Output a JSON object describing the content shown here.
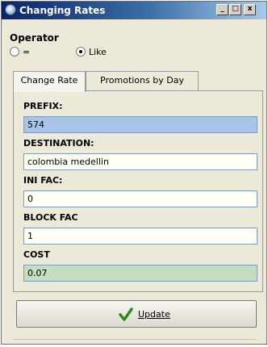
{
  "window": {
    "title": "Changing Rates",
    "controls": {
      "minimize": "_",
      "maximize": "□",
      "close": "x"
    }
  },
  "operator": {
    "label": "Operator",
    "options": [
      {
        "label": "=",
        "selected": false
      },
      {
        "label": "Like",
        "selected": true
      }
    ]
  },
  "tabs": [
    {
      "label": "Change Rate",
      "active": true
    },
    {
      "label": "Promotions by Day",
      "active": false
    }
  ],
  "fields": {
    "prefix": {
      "label": "PREFIX:",
      "value": "574"
    },
    "destination": {
      "label": "DESTINATION:",
      "value": "colombia medellin"
    },
    "ini_fac": {
      "label": "INI FAC:",
      "value": "0"
    },
    "block_fac": {
      "label": "BLOCK FAC",
      "value": "1"
    },
    "cost": {
      "label": "COST",
      "value": "0.07"
    }
  },
  "update_button": {
    "label": "Update",
    "icon": "check-icon"
  },
  "colors": {
    "titlebar_start": "#0a246a",
    "prefix_bg": "#a9c4e8",
    "cost_bg": "#c4dcc0",
    "window_bg": "#ece9d8"
  }
}
